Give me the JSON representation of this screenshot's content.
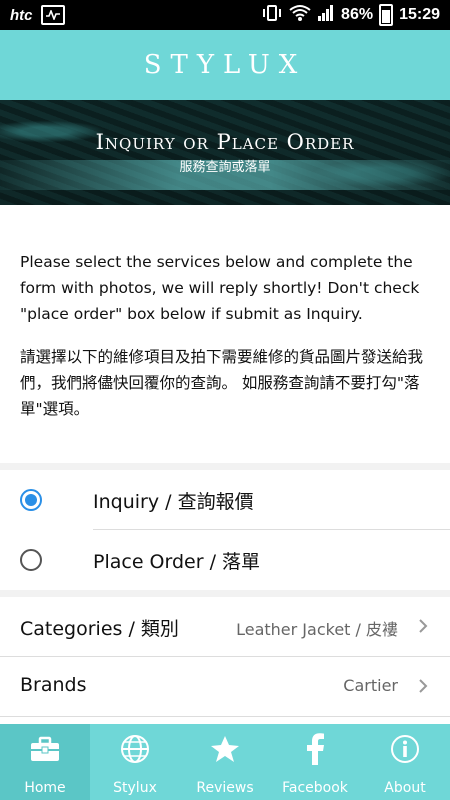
{
  "status_bar": {
    "carrier": "htc",
    "battery": "86%",
    "time": "15:29"
  },
  "header": {
    "brand": "STYLUX"
  },
  "banner": {
    "title": "Inquiry or Place Order",
    "subtitle": "服務查詢或落單"
  },
  "description": {
    "english": "Please select the services below and complete the form with photos, we will reply shortly! Don't check \"place order\" box below if submit as Inquiry.",
    "chinese": "請選擇以下的維修項目及拍下需要維修的貨品圖片發送給我們，我們將儘快回覆你的查詢。 如服務查詢請不要打勾\"落單\"選項。"
  },
  "request_type": {
    "selected": "Inquiry / 查詢報價",
    "options": [
      {
        "label": "Inquiry / 查詢報價",
        "selected": true
      },
      {
        "label": "Place Order / 落單",
        "selected": false
      }
    ]
  },
  "form": {
    "categories": {
      "label": "Categories / 類別",
      "value": "Leather Jacket / 皮褸"
    },
    "brands": {
      "label": "Brands",
      "value": "Cartier"
    }
  },
  "tabs": [
    {
      "label": "Home",
      "icon": "briefcase-icon",
      "active": true
    },
    {
      "label": "Stylux",
      "icon": "globe-icon",
      "active": false
    },
    {
      "label": "Reviews",
      "icon": "star-icon",
      "active": false
    },
    {
      "label": "Facebook",
      "icon": "facebook-icon",
      "active": false
    },
    {
      "label": "About",
      "icon": "info-icon",
      "active": false
    }
  ],
  "colors": {
    "accent": "#6fd7d7",
    "radio_selected": "#2a8fe6"
  }
}
